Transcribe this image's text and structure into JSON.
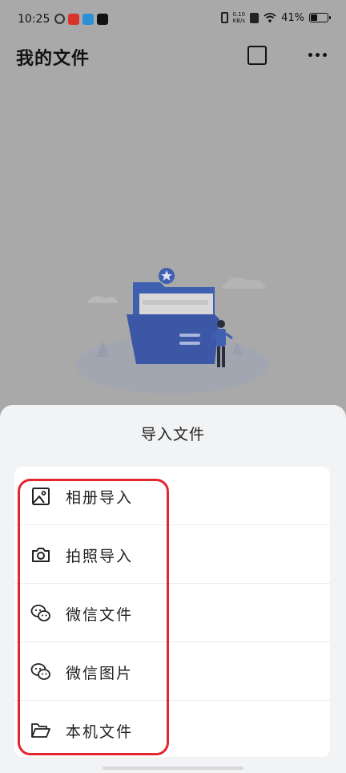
{
  "status_bar": {
    "time": "10:25",
    "net_speed_value": "0.10",
    "net_speed_unit": "KB/s",
    "battery_percent": "41%",
    "battery_level": 0.41
  },
  "header": {
    "title": "我的文件"
  },
  "sheet": {
    "title": "导入文件",
    "items": [
      {
        "label": "相册导入",
        "icon": "image-icon"
      },
      {
        "label": "拍照导入",
        "icon": "camera-icon"
      },
      {
        "label": "微信文件",
        "icon": "wechat-icon"
      },
      {
        "label": "微信图片",
        "icon": "wechat-icon"
      },
      {
        "label": "本机文件",
        "icon": "folder-open-icon"
      }
    ]
  },
  "colors": {
    "overlay_bg": "#a9a9a9",
    "sheet_bg": "#f2f3f5",
    "highlight": "#e4262f",
    "folder_blue": "#3f5fb0"
  }
}
